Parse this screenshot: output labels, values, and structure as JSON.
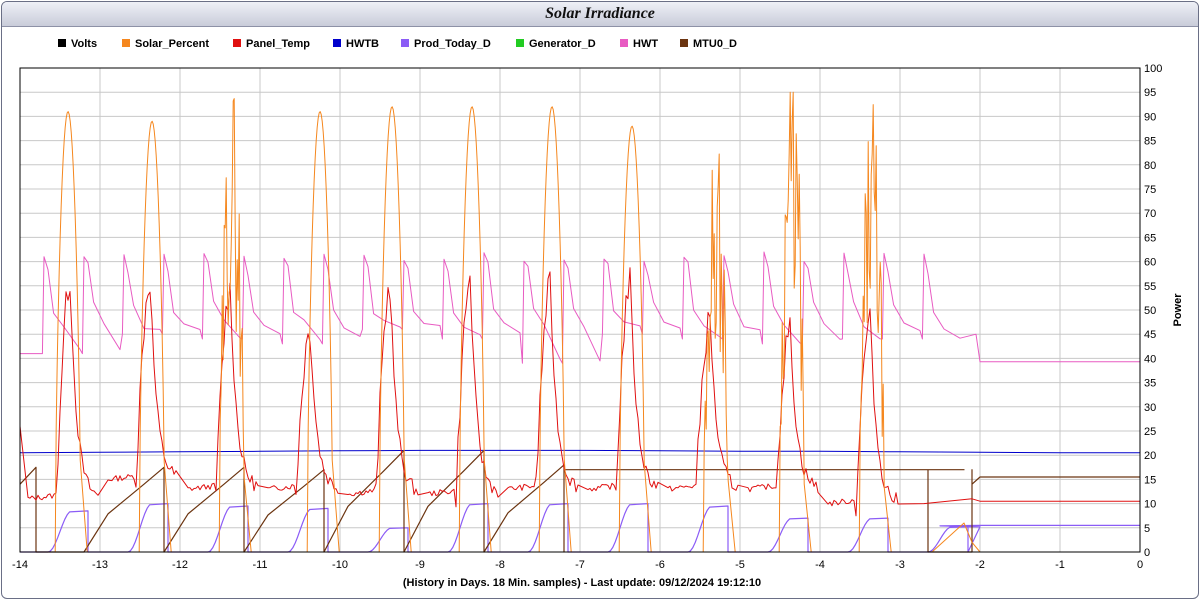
{
  "window": {
    "title": "Solar Irradiance",
    "footer": "(History in Days. 18 Min. samples) - Last update: 09/12/2024 19:12:10"
  },
  "colors": {
    "Volts": "#000000",
    "Solar_Percent": "#f5871e",
    "Panel_Temp": "#e01010",
    "HWTB": "#0000cc",
    "Prod_Today_D": "#8b5cf6",
    "Generator_D": "#22cc22",
    "HWT": "#e85bc2",
    "MTU0_D": "#6b3410",
    "grid": "#c8c8c8"
  },
  "legend": [
    "Volts",
    "Solar_Percent",
    "Panel_Temp",
    "HWTB",
    "Prod_Today_D",
    "Generator_D",
    "HWT",
    "MTU0_D"
  ],
  "chart_data": {
    "type": "line",
    "title": "Solar Irradiance",
    "xlabel": "(History in Days. 18 Min. samples) - Last update: 09/12/2024 19:12:10",
    "ylabel": "Power",
    "xlim": [
      -14,
      0
    ],
    "ylim": [
      0,
      100
    ],
    "x_ticks": [
      -14,
      -13,
      -12,
      -11,
      -10,
      -9,
      -8,
      -7,
      -6,
      -5,
      -4,
      -3,
      -2,
      -1,
      0
    ],
    "y_ticks": [
      0,
      5,
      10,
      15,
      20,
      25,
      30,
      35,
      40,
      45,
      50,
      55,
      60,
      65,
      70,
      75,
      80,
      85,
      90,
      95,
      100
    ],
    "grid": true,
    "legend_position": "top-left",
    "y_axis_side": "right",
    "days": [
      -14,
      -13,
      -12,
      -11,
      -10,
      -9,
      -8,
      -7,
      -6,
      -5,
      -4,
      -3
    ],
    "series": [
      {
        "name": "Solar_Percent",
        "peak_day_offset": [
          -13.4,
          -12.35,
          -11.35,
          -10.25,
          -9.35,
          -8.35,
          -7.35,
          -6.35,
          -5.3,
          -4.35,
          -3.35
        ],
        "peak_values": [
          91,
          89,
          90,
          91,
          92,
          92,
          92,
          88,
          80,
          95,
          86
        ]
      },
      {
        "name": "Panel_Temp",
        "start_value": 26,
        "peak_values": [
          56,
          56,
          54,
          46,
          55,
          56,
          55,
          56,
          48,
          46,
          48
        ],
        "night_values": [
          11,
          15,
          13,
          13,
          12,
          12,
          13,
          13,
          13,
          13,
          10,
          10
        ],
        "end_value": 10.5
      },
      {
        "name": "HWTB",
        "values": [
          20.5,
          20.6,
          20.7,
          20.8,
          20.9,
          21.0,
          21.0,
          21.0,
          20.9,
          20.8,
          20.8,
          20.7,
          20.6,
          20.5,
          20.5
        ],
        "x": [
          -14,
          -13,
          -12,
          -11,
          -10,
          -9,
          -8,
          -7,
          -6,
          -5,
          -4,
          -3,
          -2,
          -1,
          0
        ]
      },
      {
        "name": "HWT",
        "spike_values": [
          62,
          62,
          62,
          62,
          62,
          62,
          62,
          62,
          62,
          62,
          62,
          62,
          62,
          62,
          62,
          62,
          62,
          62,
          62,
          62,
          62,
          62,
          62,
          62
        ],
        "base_values": [
          41,
          45,
          44,
          43,
          46,
          44,
          39,
          45,
          44,
          43,
          44,
          44,
          42
        ],
        "flat_value": 39.3
      },
      {
        "name": "Prod_Today_D",
        "daily_max": [
          8.5,
          10,
          9.5,
          9,
          5,
          10,
          10,
          10,
          9.5,
          7,
          7,
          5.2,
          5.5
        ]
      },
      {
        "name": "MTU0_D",
        "daily_max": [
          17.5,
          17.5,
          17.5,
          17,
          21,
          21,
          18,
          17,
          17,
          17,
          17,
          17
        ],
        "flat_value": 15.5
      }
    ]
  }
}
